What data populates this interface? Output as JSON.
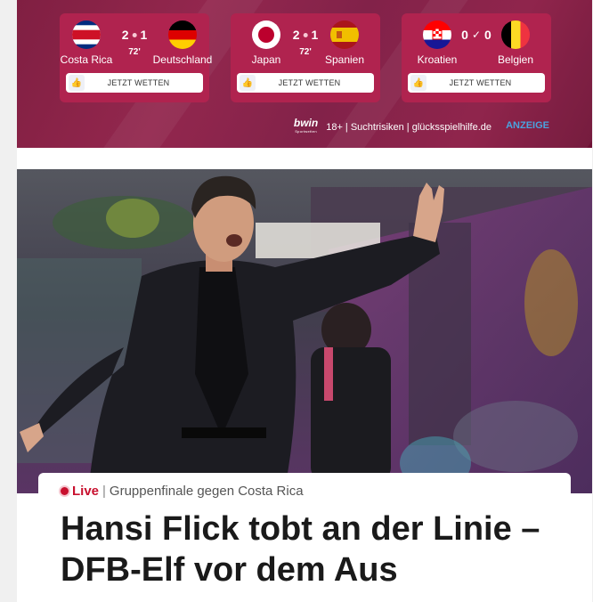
{
  "betting": {
    "matches": [
      {
        "home": "Costa Rica",
        "away": "Deutschland",
        "home_score": "2",
        "away_score": "1",
        "minute": "72'",
        "separator": "dot",
        "button": "JETZT WETTEN"
      },
      {
        "home": "Japan",
        "away": "Spanien",
        "home_score": "2",
        "away_score": "1",
        "minute": "72'",
        "separator": "dot",
        "button": "JETZT WETTEN"
      },
      {
        "home": "Kroatien",
        "away": "Belgien",
        "home_score": "0",
        "away_score": "0",
        "minute": "",
        "separator": "check",
        "button": "JETZT WETTEN"
      }
    ],
    "sponsor_logo": "bwin",
    "sponsor_logo_sub": "Sportwetten",
    "disclaimer": "18+ | Suchtrisiken | glücksspielhilfe.de",
    "ad_label": "ANZEIGE",
    "colors": {
      "banner": "#8e1c45",
      "card": "#b0234f",
      "ad_label": "#4aa3df"
    }
  },
  "article": {
    "live_label": "Live",
    "separator": "|",
    "topic": "Gruppenfinale gegen Costa Rica",
    "headline": "Hansi Flick tobt an der Linie – DFB-Elf vor dem Aus",
    "live_color": "#c8102e"
  }
}
